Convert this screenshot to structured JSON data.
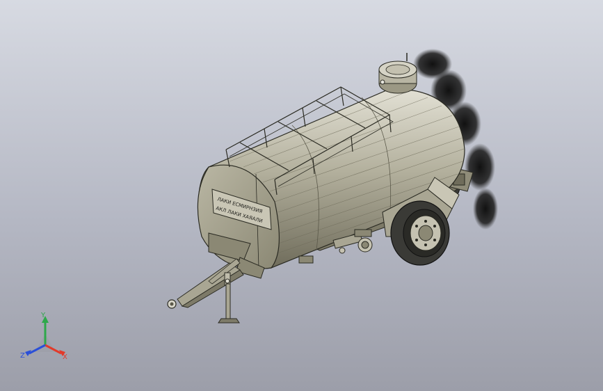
{
  "viewport": {
    "background_top": "#d7dae2",
    "background_bottom": "#9c9ea9"
  },
  "model": {
    "tank_plate": {
      "line1": "ЛАКИ ЕСМИРНЗИЯ",
      "line2": "АКЛ ЛАКИ ХАЯАЛИ"
    },
    "colors": {
      "body": "#a6a38f",
      "body_dark": "#7d7a68",
      "body_light": "#d2d0c2",
      "outline": "#2a2a22",
      "tire": "#3a3a36",
      "smoke": "#1c1c1c"
    }
  },
  "triad": {
    "x_label": "X",
    "y_label": "Y",
    "z_label": "Z",
    "x_color": "#e23a2a",
    "y_color": "#2ea84a",
    "z_color": "#2a4fd8"
  }
}
